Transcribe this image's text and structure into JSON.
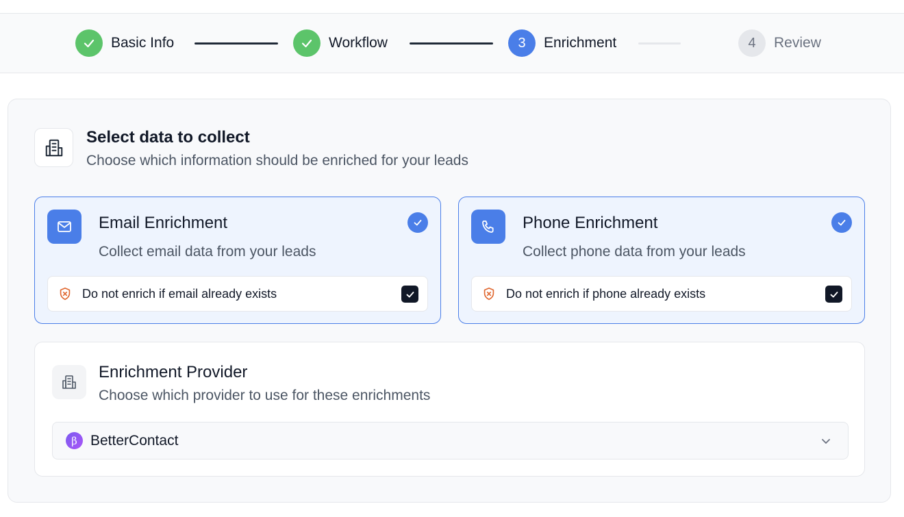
{
  "stepper": {
    "steps": [
      {
        "label": "Basic Info",
        "status": "done",
        "number": ""
      },
      {
        "label": "Workflow",
        "status": "done",
        "number": ""
      },
      {
        "label": "Enrichment",
        "status": "active",
        "number": "3"
      },
      {
        "label": "Review",
        "status": "pending",
        "number": "4"
      }
    ]
  },
  "section": {
    "icon": "building-icon",
    "title": "Select data to collect",
    "subtitle": "Choose which information should be enriched for your leads"
  },
  "cards": [
    {
      "icon": "mail-icon",
      "title": "Email Enrichment",
      "description": "Collect email data from your leads",
      "selected": true,
      "option_label": "Do not enrich if email already exists",
      "option_checked": true
    },
    {
      "icon": "phone-icon",
      "title": "Phone Enrichment",
      "description": "Collect phone data from your leads",
      "selected": true,
      "option_label": "Do not enrich if phone already exists",
      "option_checked": true
    }
  ],
  "provider": {
    "icon": "building-icon",
    "title": "Enrichment Provider",
    "subtitle": "Choose which provider to use for these enrichments",
    "selected_value": "BetterContact",
    "brand_glyph": "β"
  },
  "colors": {
    "accent": "#4a7ee8",
    "success": "#5cc46a",
    "warning": "#e0672f"
  }
}
